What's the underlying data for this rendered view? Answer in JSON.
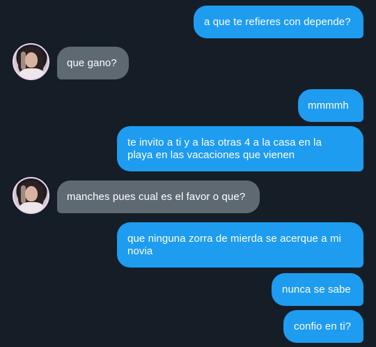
{
  "conversation": {
    "messages": [
      {
        "direction": "outgoing",
        "lines": [
          "a que te refieres con depende?"
        ]
      },
      {
        "direction": "incoming",
        "lines": [
          "que gano?"
        ]
      },
      {
        "direction": "outgoing",
        "lines": [
          "mmmmh"
        ]
      },
      {
        "direction": "outgoing",
        "lines": [
          "te invito a ti y a las otras 4 a la casa en la",
          "playa en las vacaciones que vienen"
        ]
      },
      {
        "direction": "incoming",
        "lines": [
          "manches pues cual es el favor o que?"
        ]
      },
      {
        "direction": "outgoing",
        "lines": [
          "que ninguna zorra de mierda se acerque a mi",
          "novia"
        ]
      },
      {
        "direction": "outgoing",
        "lines": [
          "nunca se sabe"
        ]
      },
      {
        "direction": "outgoing",
        "lines": [
          "confio en ti?"
        ]
      }
    ]
  },
  "colors": {
    "background": "#151d26",
    "outgoing_bubble": "#1e9cf0",
    "incoming_bubble": "#5f6972",
    "text": "#ffffff"
  },
  "icons": {
    "contact_avatar": "avatar-photo-icon"
  }
}
